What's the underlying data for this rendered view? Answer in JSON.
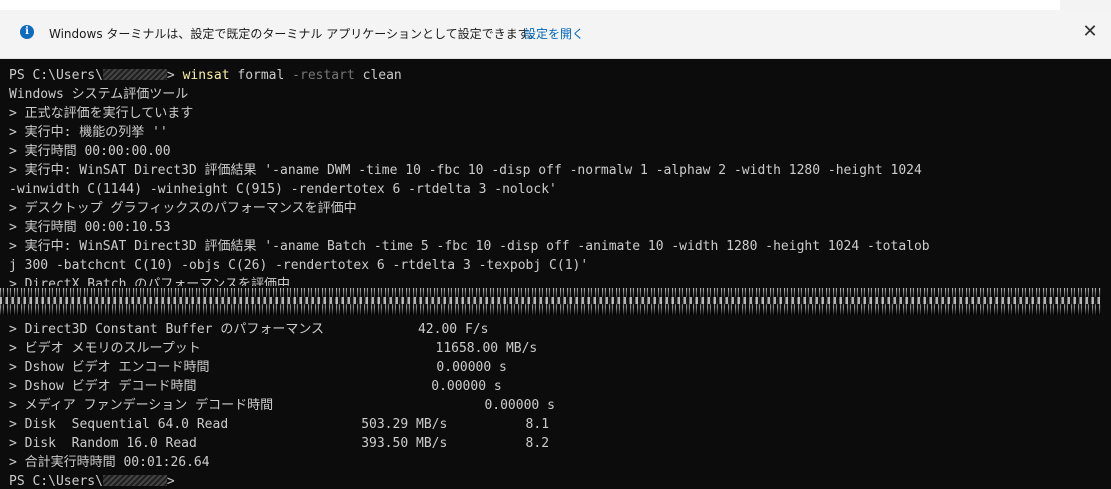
{
  "infobar": {
    "message": "Windows ターミナルは、設定で既定のターミナル アプリケーションとして設定できます。",
    "link": "設定を開く",
    "close_glyph": "✕",
    "info_glyph": "i"
  },
  "terminal": {
    "prompt_prefix": "PS C:\\Users\\",
    "prompt_suffix": "> ",
    "command": "winsat",
    "command_arg1": " formal ",
    "command_param": "-restart",
    "command_arg2": " clean",
    "lines": [
      "Windows システム評価ツール",
      "> 正式な評価を実行しています",
      "> 実行中: 機能の列挙 ''",
      "> 実行時間 00:00:00.00",
      "> 実行中: WinSAT Direct3D 評価結果 '-aname DWM -time 10 -fbc 10 -disp off -normalw 1 -alphaw 2 -width 1280 -height 1024",
      "-winwidth C(1144) -winheight C(915) -rendertotex 6 -rtdelta 3 -nolock'",
      "> デスクトップ グラフィックスのパフォーマンスを評価中",
      "> 実行時間 00:00:10.53",
      "> 実行中: WinSAT Direct3D 評価結果 '-aname Batch -time 5 -fbc 10 -disp off -animate 10 -width 1280 -height 1024 -totalob",
      "j 300 -batchcnt C(10) -objs C(26) -rendertotex 6 -rtdelta 3 -texpobj C(1)'",
      "> DirectX Batch のパフォーマンスを評価中"
    ],
    "results": [
      "> Direct3D Constant Buffer のパフォーマンス            42.00 F/s",
      "> ビデオ メモリのスループット                              11658.00 MB/s",
      "> Dshow ビデオ エンコード時間                             0.00000 s",
      "> Dshow ビデオ デコード時間                              0.00000 s",
      "> メディア ファンデーション デコード時間                           0.00000 s",
      "> Disk  Sequential 64.0 Read                 503.29 MB/s          8.1",
      "> Disk  Random 16.0 Read                     393.50 MB/s          8.2",
      "> 合計実行時時間 00:01:26.64"
    ]
  }
}
